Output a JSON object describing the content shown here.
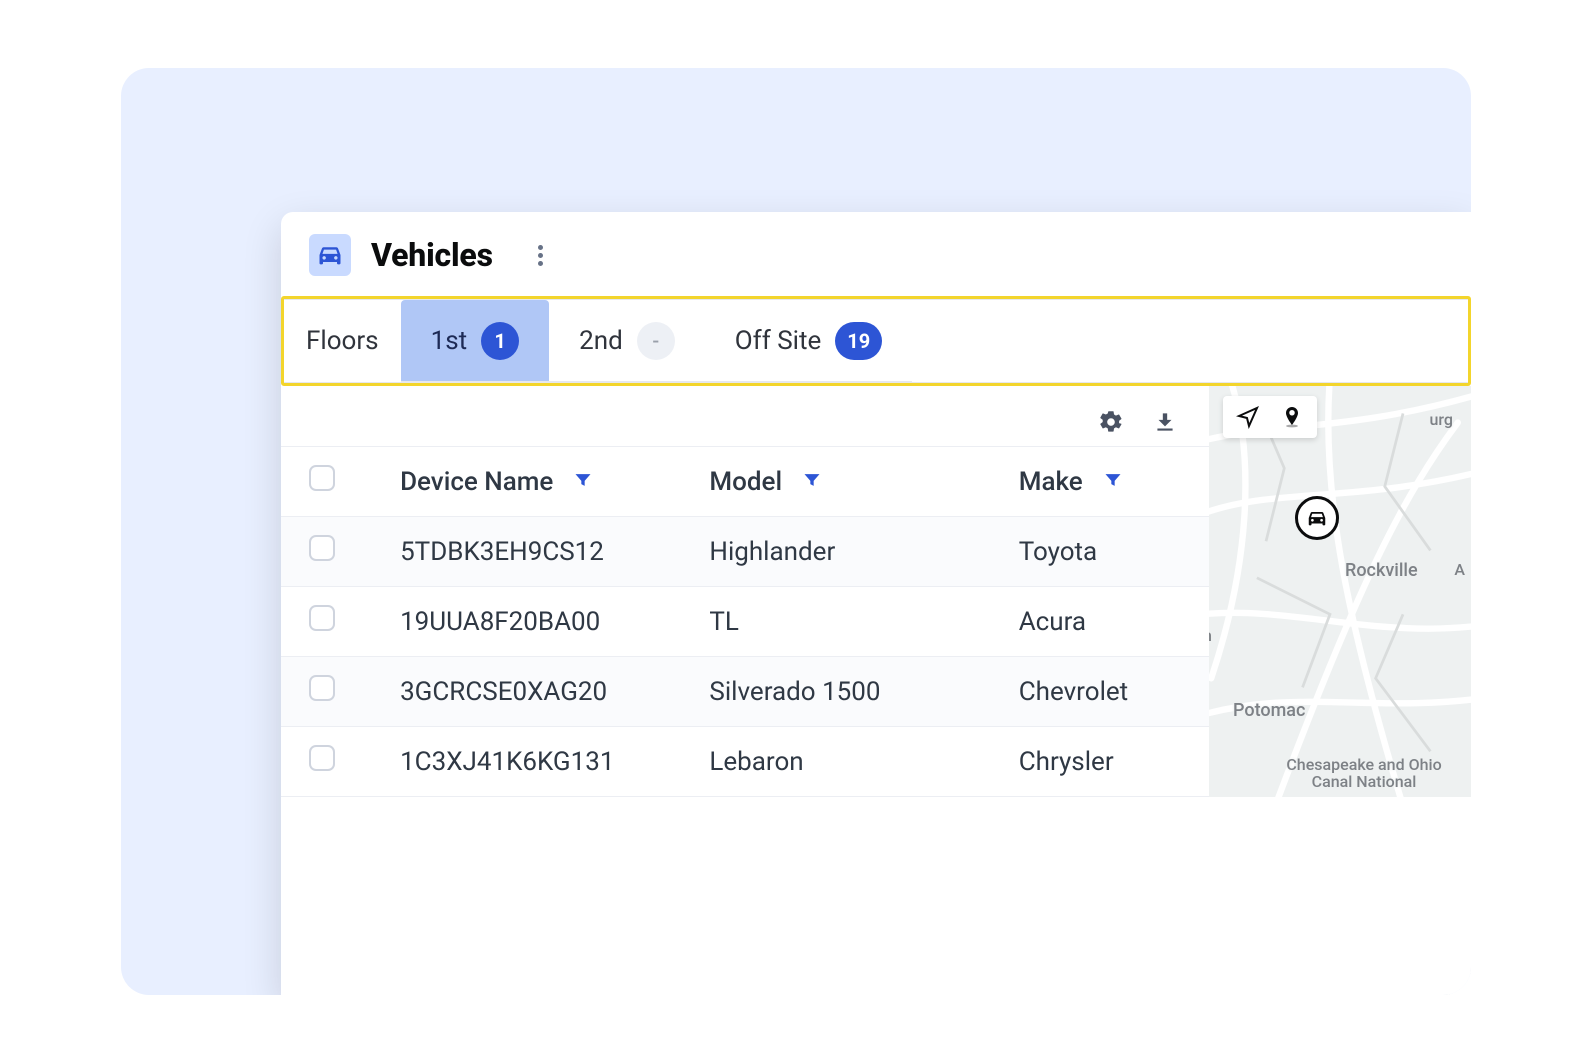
{
  "header": {
    "title": "Vehicles"
  },
  "floors": {
    "label": "Floors",
    "tabs": [
      {
        "label": "1st",
        "count": "1",
        "active": true
      },
      {
        "label": "2nd",
        "count": "-",
        "active": false
      },
      {
        "label": "Off Site",
        "count": "19",
        "active": false
      }
    ]
  },
  "table": {
    "columns": {
      "device": "Device Name",
      "model": "Model",
      "make": "Make"
    },
    "rows": [
      {
        "device": "5TDBK3EH9CS12",
        "model": "Highlander",
        "make": "Toyota"
      },
      {
        "device": "19UUA8F20BA00",
        "model": "TL",
        "make": "Acura"
      },
      {
        "device": "3GCRCSE0XAG20",
        "model": "Silverado 1500",
        "make": "Chevrolet"
      },
      {
        "device": "1C3XJ41K6KG131",
        "model": "Lebaron",
        "make": "Chrysler"
      }
    ]
  },
  "map": {
    "labels": {
      "fragment_ne": "urg",
      "rockville": "Rockville",
      "a": "A",
      "h": "h",
      "potomac": "Potomac",
      "coc": "Chesapeake and Ohio Canal National"
    }
  }
}
